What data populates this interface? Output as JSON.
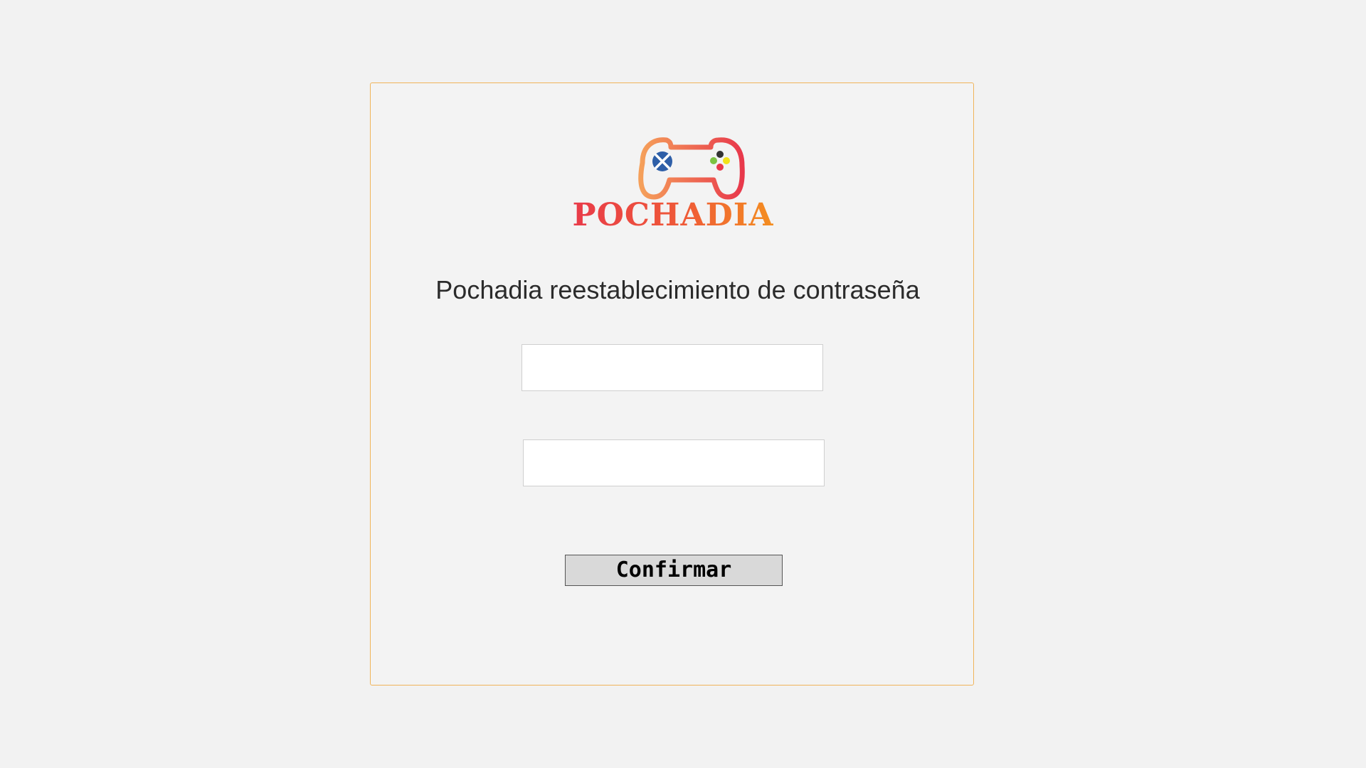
{
  "brand": {
    "name": "POCHADIA",
    "logo_icon": "gamepad-icon",
    "gradient_colors": [
      "#e8384b",
      "#f4941e"
    ]
  },
  "form": {
    "title": "Pochadia reestablecimiento de contraseña",
    "password_value": "",
    "password_placeholder": "",
    "confirm_password_value": "",
    "confirm_password_placeholder": "",
    "confirm_button_label": "Confirmar"
  },
  "colors": {
    "background": "#f2f2f2",
    "card_border": "#f0b45a",
    "button_bg": "#d9d9d9"
  }
}
